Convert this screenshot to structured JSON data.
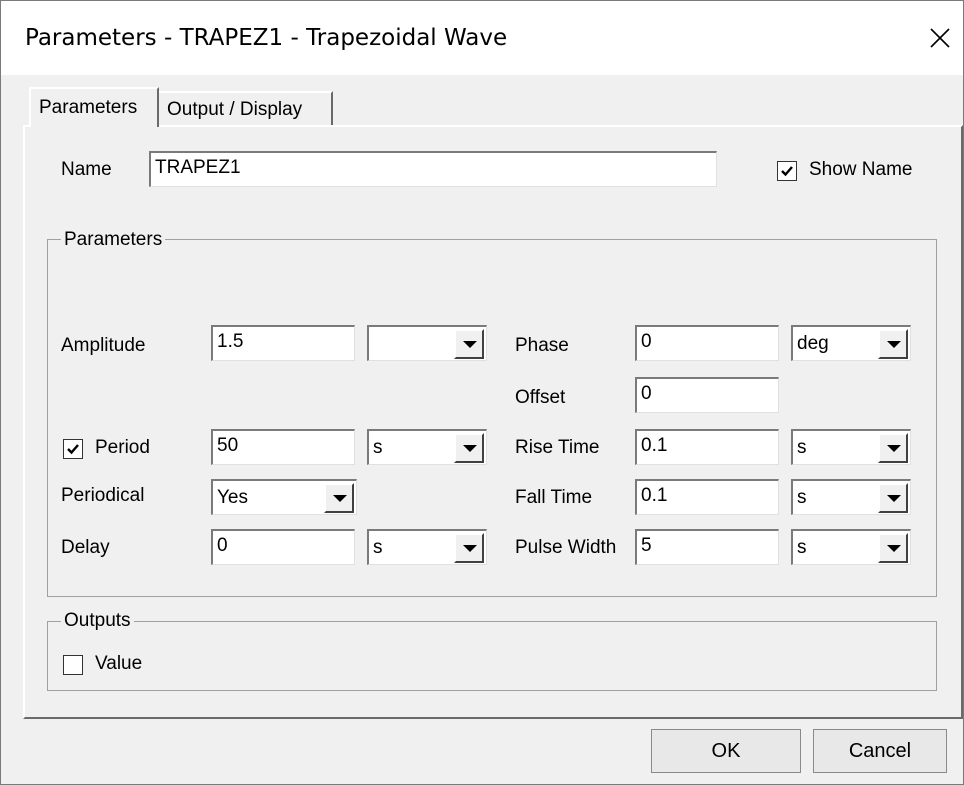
{
  "window": {
    "title": "Parameters - TRAPEZ1 - Trapezoidal Wave"
  },
  "tabs": [
    {
      "label": "Parameters"
    },
    {
      "label": "Output / Display"
    }
  ],
  "name_row": {
    "label": "Name",
    "value": "TRAPEZ1",
    "show_name_label": "Show Name",
    "show_name_checked": true
  },
  "params_group": {
    "title": "Parameters",
    "amplitude": {
      "label": "Amplitude",
      "value": "1.5",
      "unit": ""
    },
    "period": {
      "label": "Period",
      "checked": true,
      "value": "50",
      "unit": "s"
    },
    "periodical": {
      "label": "Periodical",
      "value": "Yes"
    },
    "delay": {
      "label": "Delay",
      "value": "0",
      "unit": "s"
    },
    "phase": {
      "label": "Phase",
      "value": "0",
      "unit": "deg"
    },
    "offset": {
      "label": "Offset",
      "value": "0"
    },
    "rise_time": {
      "label": "Rise Time",
      "value": "0.1",
      "unit": "s"
    },
    "fall_time": {
      "label": "Fall Time",
      "value": "0.1",
      "unit": "s"
    },
    "pulse_width": {
      "label": "Pulse Width",
      "value": "5",
      "unit": "s"
    }
  },
  "outputs_group": {
    "title": "Outputs",
    "value_label": "Value",
    "value_checked": false
  },
  "buttons": {
    "ok": "OK",
    "cancel": "Cancel"
  }
}
